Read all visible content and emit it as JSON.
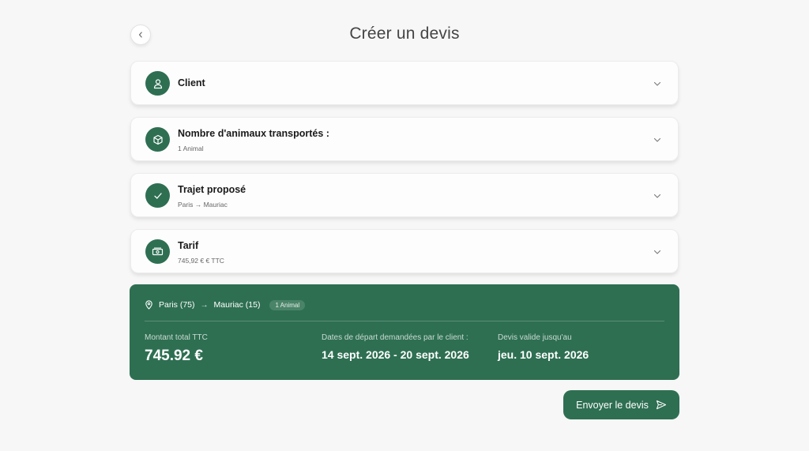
{
  "page": {
    "title": "Créer un devis"
  },
  "cards": [
    {
      "title": "Client",
      "subtitle": "",
      "icon": "user-icon"
    },
    {
      "title": "Nombre d'animaux transportés :",
      "subtitle": "1 Animal",
      "icon": "box-icon"
    },
    {
      "title": "Trajet proposé",
      "subtitle": "Paris → Mauriac",
      "icon": "check-icon"
    },
    {
      "title": "Tarif",
      "subtitle": "745,92 € € TTC",
      "icon": "banknote-icon"
    }
  ],
  "summary": {
    "from": "Paris (75)",
    "to": "Mauriac (15)",
    "animals_badge": "1 Animal",
    "total_label": "Montant total TTC",
    "total_value": "745.92 €",
    "dates_label": "Dates de départ demandées par le client :",
    "dates_value": "14 sept. 2026 - 20 sept. 2026",
    "valid_label": "Devis valide jusqu'au",
    "valid_value": "jeu. 10 sept. 2026"
  },
  "actions": {
    "send_label": "Envoyer le devis"
  },
  "colors": {
    "accent": "#2e6f52",
    "background": "#f7f7f7"
  }
}
